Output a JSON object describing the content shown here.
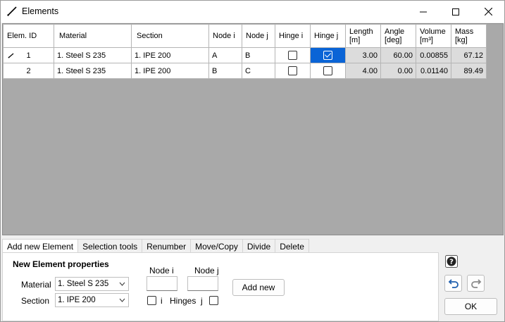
{
  "window": {
    "title": "Elements",
    "icon": "line-element-icon"
  },
  "grid": {
    "headers": {
      "elem_id": "Elem. ID",
      "material": "Material",
      "section": "Section",
      "node_i": "Node i",
      "node_j": "Node j",
      "hinge_i": "Hinge i",
      "hinge_j": "Hinge j",
      "length": "Length",
      "length_unit": "[m]",
      "angle": "Angle",
      "angle_unit": "[deg]",
      "volume": "Volume",
      "volume_unit": "[m³]",
      "mass": "Mass",
      "mass_unit": "[kg]"
    },
    "rows": [
      {
        "id": "1",
        "material": "1. Steel S 235",
        "section": "1. IPE 200",
        "node_i": "A",
        "node_j": "B",
        "hinge_i": false,
        "hinge_j": true,
        "length": "3.00",
        "angle": "60.00",
        "volume": "0.00855",
        "mass": "67.12"
      },
      {
        "id": "2",
        "material": "1. Steel S 235",
        "section": "1. IPE 200",
        "node_i": "B",
        "node_j": "C",
        "hinge_i": false,
        "hinge_j": false,
        "length": "4.00",
        "angle": "0.00",
        "volume": "0.01140",
        "mass": "89.49"
      }
    ]
  },
  "tabs": [
    {
      "label": "Add new Element",
      "active": true
    },
    {
      "label": "Selection tools",
      "active": false
    },
    {
      "label": "Renumber",
      "active": false
    },
    {
      "label": "Move/Copy",
      "active": false
    },
    {
      "label": "Divide",
      "active": false
    },
    {
      "label": "Delete",
      "active": false
    }
  ],
  "panel": {
    "title": "New Element properties",
    "material_label": "Material",
    "material_value": "1. Steel S 235",
    "section_label": "Section",
    "section_value": "1. IPE 200",
    "node_i_label": "Node i",
    "node_i_value": "",
    "node_j_label": "Node j",
    "node_j_value": "",
    "hinge_i_label": "i",
    "hinges_label": "Hinges",
    "hinge_j_label": "j",
    "add_button": "Add new"
  },
  "side": {
    "help_icon": "help-icon",
    "undo_icon": "undo-icon",
    "redo_icon": "redo-icon",
    "ok_button": "OK"
  },
  "colors": {
    "selection": "#0a64d6",
    "readonly_cell": "#dcdcdc",
    "grid_bg": "#a9a9a9"
  }
}
